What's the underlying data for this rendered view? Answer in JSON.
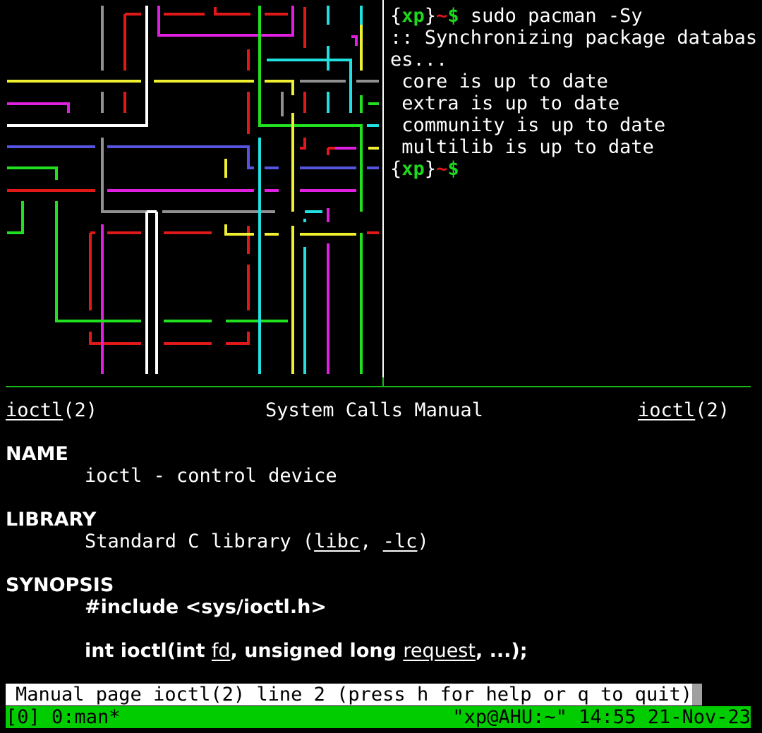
{
  "pipes": {
    "colors": {
      "red": "#e01818",
      "magenta": "#e020e0",
      "green": "#20e020",
      "yellow": "#f0f030",
      "cyan": "#20e0e0",
      "blue": "#5555e0",
      "white": "#ffffff",
      "gray": "#909090"
    }
  },
  "terminal": {
    "prompt_open": "{",
    "prompt_user": "xp",
    "prompt_close": "}",
    "prompt_tilde": "~",
    "prompt_dollar": "$",
    "command": " sudo pacman -Sy",
    "output": [
      ":: Synchronizing package databas",
      "es...",
      " core is up to date",
      " extra is up to date",
      " community is up to date",
      " multilib is up to date"
    ]
  },
  "man": {
    "header_left_name": "ioctl",
    "header_left_sect": "(2)",
    "header_center": "System Calls Manual",
    "header_right_name": "ioctl",
    "header_right_sect": "(2)",
    "name_heading": "NAME",
    "name_text": "ioctl - control device",
    "library_heading": "LIBRARY",
    "library_prefix": "Standard C library (",
    "library_libc": "libc",
    "library_sep": ", ",
    "library_lc": "-lc",
    "library_suffix": ")",
    "synopsis_heading": "SYNOPSIS",
    "include_line": "#include <sys/ioctl.h>",
    "proto_part1": "int ioctl(int ",
    "proto_fd": "fd",
    "proto_part2": ", unsigned long ",
    "proto_request": "request",
    "proto_part3": ", ...);"
  },
  "less_status": "Manual page ioctl(2) line 2 (press h for help or q to quit)",
  "tmux": {
    "left": "[0] 0:man*",
    "right": "\"xp@AHU:~\" 14:55 21-Nov-23",
    "bg_color": "#00cc00"
  }
}
